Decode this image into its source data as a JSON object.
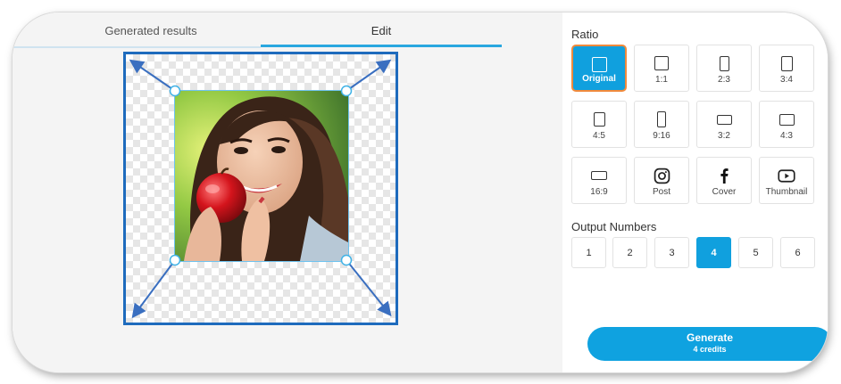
{
  "tabs": [
    {
      "label": "Generated results"
    },
    {
      "label": "Edit"
    }
  ],
  "ratio": {
    "title": "Ratio",
    "options": [
      {
        "label": "Original",
        "icon": "square-outline-icon"
      },
      {
        "label": "1:1",
        "icon": "square-icon"
      },
      {
        "label": "2:3",
        "icon": "portrait-icon"
      },
      {
        "label": "3:4",
        "icon": "portrait-icon"
      },
      {
        "label": "4:5",
        "icon": "portrait-icon"
      },
      {
        "label": "9:16",
        "icon": "tall-portrait-icon"
      },
      {
        "label": "3:2",
        "icon": "landscape-icon"
      },
      {
        "label": "4:3",
        "icon": "landscape-icon"
      },
      {
        "label": "16:9",
        "icon": "wide-landscape-icon"
      },
      {
        "label": "Post",
        "icon": "instagram-icon"
      },
      {
        "label": "Cover",
        "icon": "facebook-icon"
      },
      {
        "label": "Thumbnail",
        "icon": "youtube-icon"
      }
    ],
    "selected": "Original"
  },
  "output_numbers": {
    "title": "Output Numbers",
    "options": [
      "1",
      "2",
      "3",
      "4",
      "5",
      "6"
    ],
    "selected": "4"
  },
  "generate": {
    "label": "Generate",
    "credits": "4 credits"
  },
  "colors": {
    "accent": "#10a0de",
    "selected_border": "#f08a3c",
    "canvas_border": "#1e6bbd"
  }
}
